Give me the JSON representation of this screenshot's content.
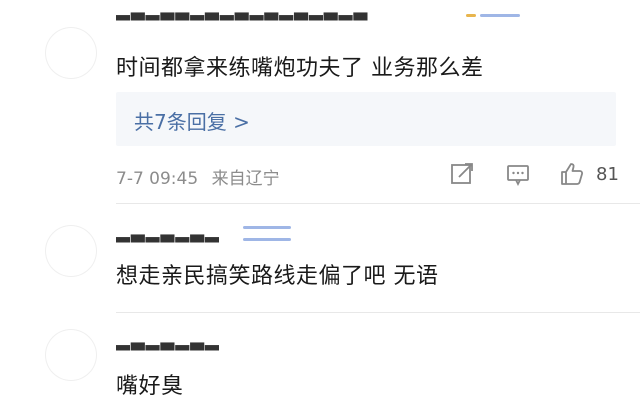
{
  "comments": [
    {
      "text": "时间都拿来练嘴炮功夫了 业务那么差",
      "replies_label": "共7条回复 >",
      "timestamp": "7-7 09:45",
      "source": "来自辽宁",
      "likes": "81",
      "icons": [
        "share-icon",
        "comment-icon",
        "like-icon"
      ]
    },
    {
      "text": "想走亲民搞笑路线走偏了吧 无语"
    },
    {
      "text": "嘴好臭"
    }
  ],
  "colors": {
    "link": "#4a6fa5",
    "meta": "#8c8c8c",
    "reply_bg": "#f5f7fa"
  }
}
